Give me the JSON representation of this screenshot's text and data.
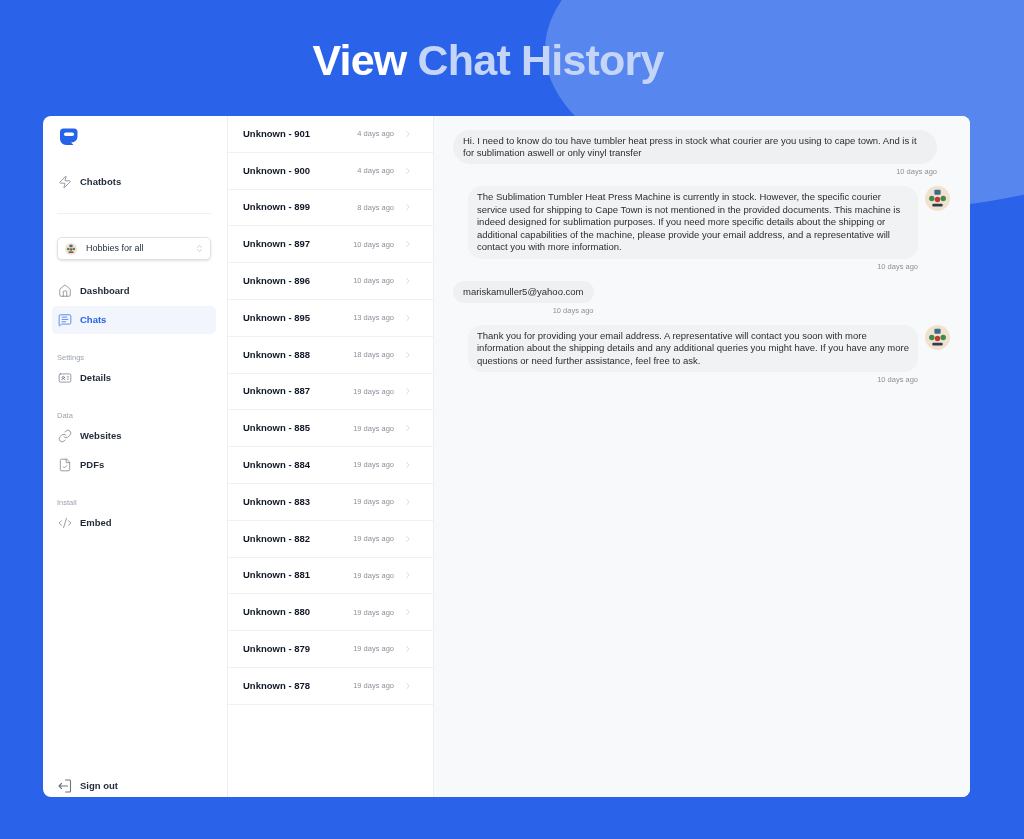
{
  "headline": {
    "parts": [
      {
        "text": "View",
        "accent": false
      },
      {
        "text": "Chat History",
        "accent": true
      }
    ]
  },
  "sidebar": {
    "chatbots_link": {
      "label": "Chatbots"
    },
    "bot_select": {
      "value": "Hobbies for all"
    },
    "nav": [
      {
        "label": "Dashboard",
        "selected": false
      },
      {
        "label": "Chats",
        "selected": true
      }
    ],
    "sections": [
      {
        "heading": "Settings",
        "items": [
          {
            "label": "Details",
            "selected": false
          }
        ]
      },
      {
        "heading": "Data",
        "items": [
          {
            "label": "Websites",
            "selected": false
          },
          {
            "label": "PDFs",
            "selected": false
          }
        ]
      },
      {
        "heading": "Install",
        "items": [
          {
            "label": "Embed",
            "selected": false
          }
        ]
      }
    ],
    "sign_out": {
      "label": "Sign out"
    }
  },
  "chat_list": {
    "rows": [
      {
        "name": "Unknown - 901",
        "time": "4 days ago",
        "selected": false
      },
      {
        "name": "Unknown - 900",
        "time": "4 days ago",
        "selected": false
      },
      {
        "name": "Unknown - 899",
        "time": "8 days ago",
        "selected": false
      },
      {
        "name": "Unknown - 897",
        "time": "10 days ago",
        "selected": false
      },
      {
        "name": "Unknown - 896",
        "time": "10 days ago",
        "selected": false
      },
      {
        "name": "Unknown - 895",
        "time": "13 days ago",
        "selected": false
      },
      {
        "name": "Unknown - 888",
        "time": "18 days ago",
        "selected": false
      },
      {
        "name": "Unknown - 887",
        "time": "19 days ago",
        "selected": false
      },
      {
        "name": "Unknown - 885",
        "time": "19 days ago",
        "selected": false
      },
      {
        "name": "Unknown - 884",
        "time": "19 days ago",
        "selected": false
      },
      {
        "name": "Unknown - 883",
        "time": "19 days ago",
        "selected": false
      },
      {
        "name": "Unknown - 882",
        "time": "19 days ago",
        "selected": false
      },
      {
        "name": "Unknown - 881",
        "time": "19 days ago",
        "selected": false
      },
      {
        "name": "Unknown - 880",
        "time": "19 days ago",
        "selected": false
      },
      {
        "name": "Unknown - 879",
        "time": "19 days ago",
        "selected": false
      },
      {
        "name": "Unknown - 878",
        "time": "19 days ago",
        "selected": false
      }
    ]
  },
  "conversation": {
    "messages": [
      {
        "kind": "user",
        "text": "Hi. I need to know do tou have tumbler heat press in stock what courier are you using to cape town. And is it for sublimation aswell or only vinyl transfer",
        "time": "10 days ago"
      },
      {
        "kind": "bot",
        "text": "The Sublimation Tumbler Heat Press Machine is currently in stock. However, the specific courier service used for shipping to Cape Town is not mentioned in the provided documents. This machine is indeed designed for sublimation purposes. If you need more specific details about the shipping or additional capabilities of the machine, please provide your email address, and a representative will contact you with more information.",
        "time": "10 days ago"
      },
      {
        "kind": "user",
        "text": "mariskamuller5@yahoo.com",
        "time": "10 days ago"
      },
      {
        "kind": "bot",
        "text": "Thank you for providing your email address. A representative will contact you soon with more information about the shipping details and any additional queries you might have. If you have any more questions or need further assistance, feel free to ask.",
        "time": "10 days ago"
      }
    ]
  }
}
